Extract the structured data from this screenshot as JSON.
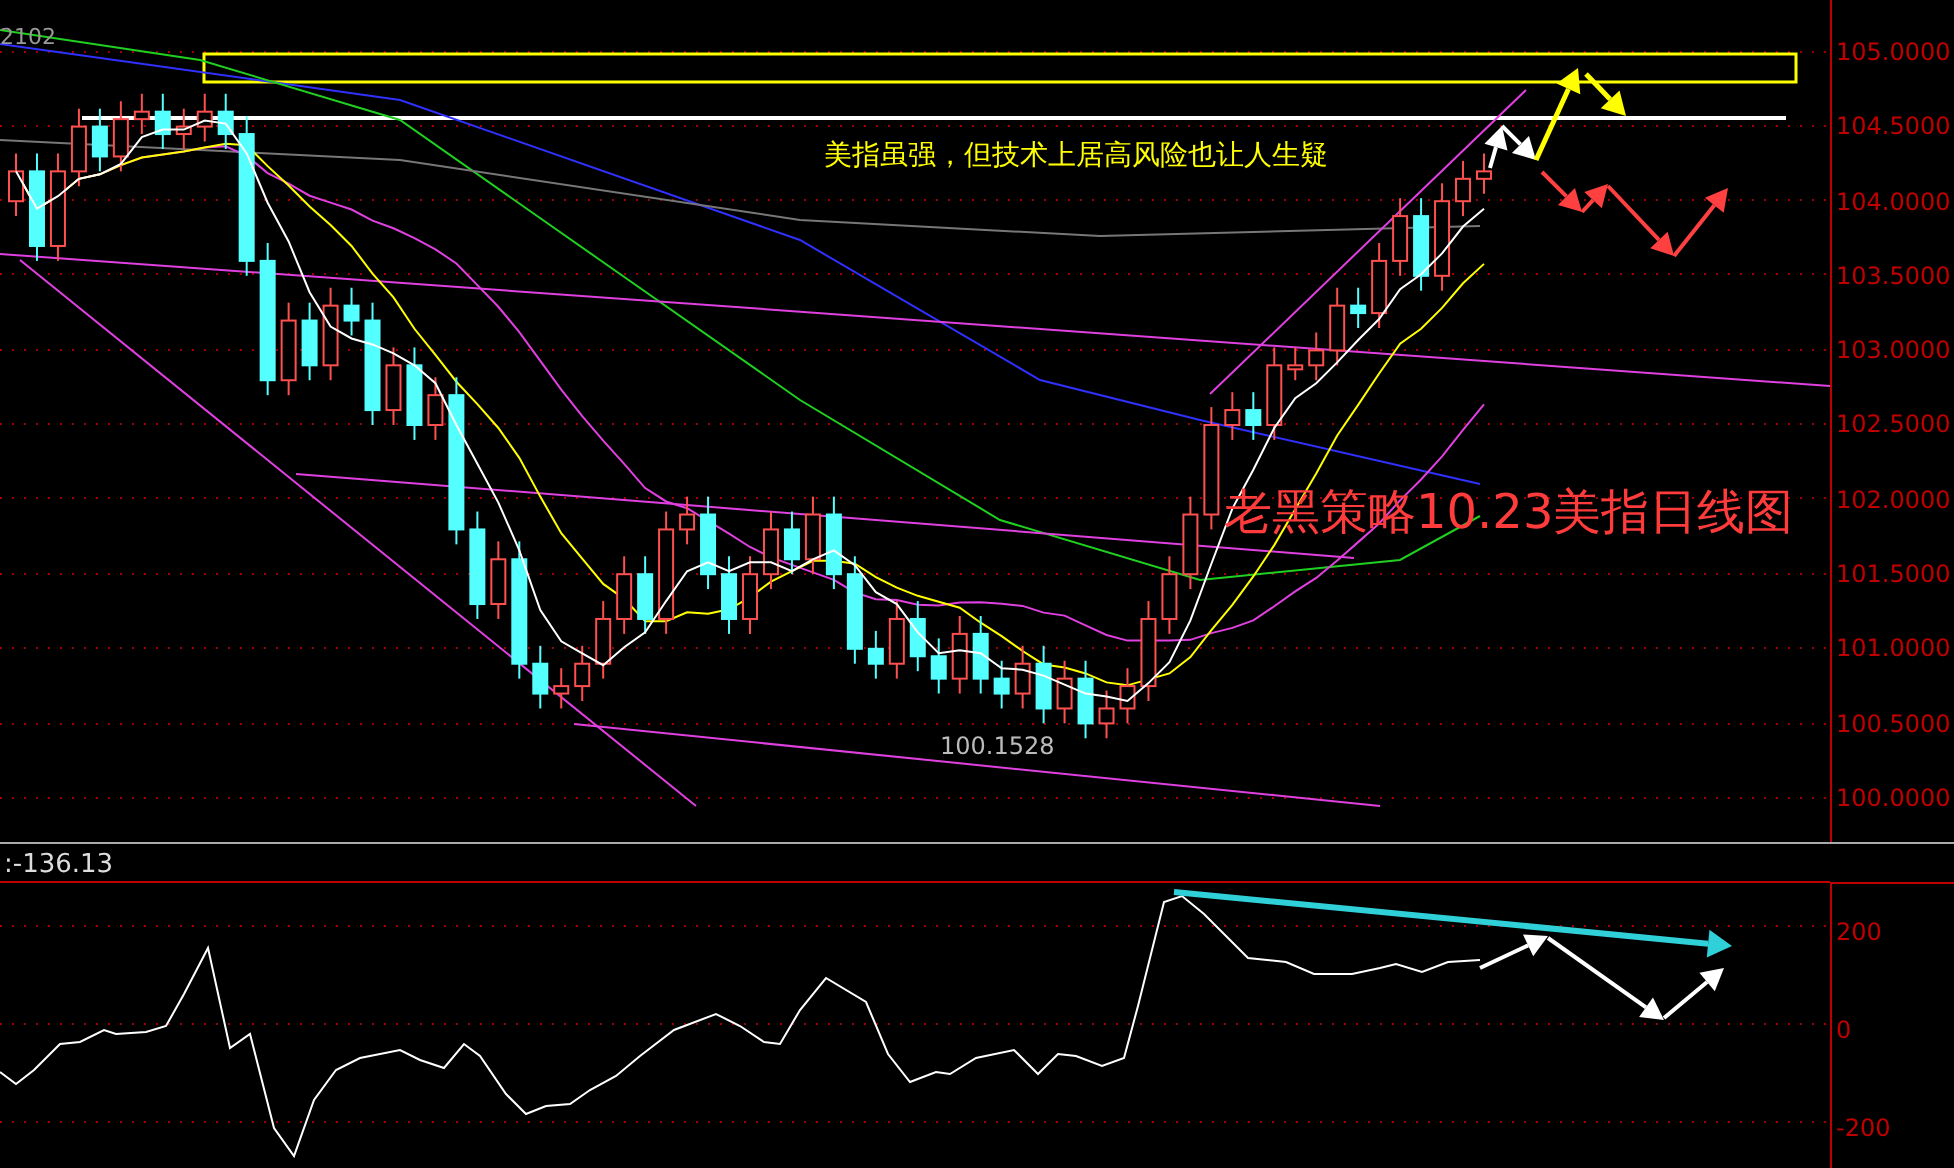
{
  "price_panel": {
    "corner_value": "2102",
    "annotation": "美指虽强，但技术上居高风险也让人生疑",
    "title": "老黑策略10.23美指日线图",
    "low_label": "100.1528",
    "y_axis": [
      "105.0000",
      "104.5000",
      "104.0000",
      "103.5000",
      "103.0000",
      "102.5000",
      "102.0000",
      "101.5000",
      "101.0000",
      "100.5000",
      "100.0000"
    ]
  },
  "indicator_panel": {
    "value": ":-136.13",
    "y_axis": [
      "200",
      "0",
      "-200"
    ]
  }
}
